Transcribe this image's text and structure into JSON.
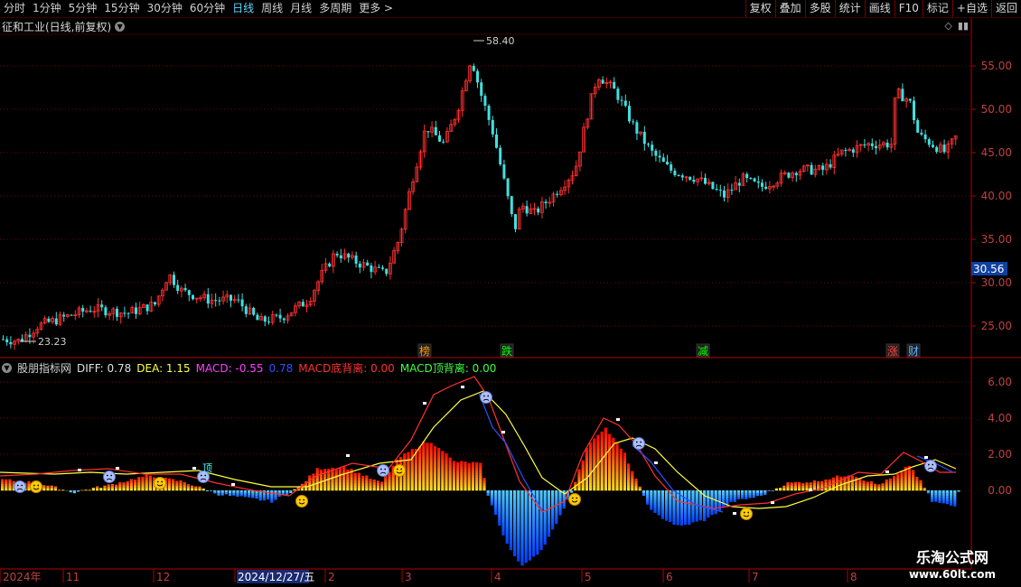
{
  "toolbar": {
    "periods": [
      "分时",
      "1分钟",
      "5分钟",
      "15分钟",
      "30分钟",
      "60分钟",
      "日线",
      "周线",
      "月线",
      "多周期",
      "更多 >"
    ],
    "active": "日线",
    "right_buttons": [
      "复权",
      "叠加",
      "多股",
      "统计",
      "画线",
      "F10",
      "标记",
      "+自选",
      "返回"
    ]
  },
  "stock": {
    "title": "征和工业(日线,前复权)"
  },
  "price_chart": {
    "y_ticks": [
      "55.00",
      "50.00",
      "45.00",
      "40.00",
      "35.00",
      "30.00",
      "25.00"
    ],
    "high_label": "58.40",
    "low_label": "23.23",
    "current_price": "30.56",
    "markers": [
      {
        "text": "榜",
        "color": "#ff9900"
      },
      {
        "text": "跌",
        "color": "#00ff00"
      },
      {
        "text": "减",
        "color": "#00ff00"
      },
      {
        "text": "涨",
        "color": "#ff4040"
      },
      {
        "text": "财",
        "color": "#5fb0ff"
      }
    ]
  },
  "indicator": {
    "name": "股朋指标网",
    "diff_label": "DIFF: 0.78",
    "dea_label": "DEA: 1.15",
    "macd_label": "MACD: -0.55",
    "blue_value": "0.78",
    "bottom_div_label": "MACD底背离: 0.00",
    "top_div_label": "MACD顶背离: 0.00",
    "y_ticks": [
      "6.00",
      "4.00",
      "2.00",
      "0.00"
    ],
    "note_text": "顶",
    "colors": {
      "diff": "#ff3030",
      "dea": "#ffff40",
      "macd": "#ff40ff",
      "blue": "#3050ff",
      "bottom": "#ff3030",
      "top": "#40ff40"
    }
  },
  "time_axis": {
    "labels": [
      "2024年",
      "11",
      "12",
      "2024/12/27/五",
      "2",
      "3",
      "4",
      "5",
      "6",
      "7",
      "8"
    ]
  },
  "watermark": {
    "name": "乐淘公式网",
    "url": "www.60lt.com"
  }
}
